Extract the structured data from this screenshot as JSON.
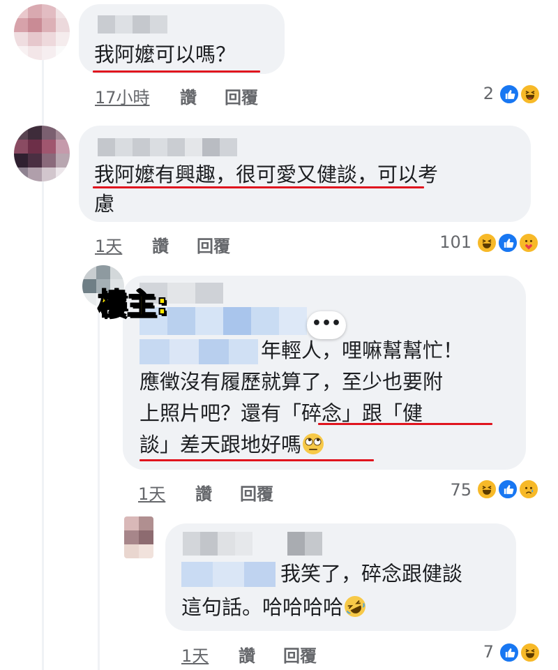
{
  "comments": [
    {
      "text": "我阿嬤可以嗎？",
      "time": "17小時",
      "like_label": "讚",
      "reply_label": "回覆",
      "reaction_count": "2"
    },
    {
      "text_line1": "我阿嬤有興趣，很可愛又健談，可以考",
      "text_line2": "慮",
      "time": "1天",
      "like_label": "讚",
      "reply_label": "回覆",
      "reaction_count": "101"
    },
    {
      "badge": "樓主:",
      "more_label": "•••",
      "text_line1": "年輕人，哩嘛幫幫忙！",
      "text_line2": "應徵沒有履歷就算了，至少也要附",
      "text_line3": "上照片吧？還有「碎念」跟「健",
      "text_line4": "談」差天跟地好嗎",
      "time": "1天",
      "like_label": "讚",
      "reply_label": "回覆",
      "reaction_count": "75"
    },
    {
      "text_line1": "我笑了，碎念跟健談",
      "text_line2": "這句話。哈哈哈哈",
      "time": "1天",
      "like_label": "讚",
      "reply_label": "回覆",
      "reaction_count": "7"
    }
  ],
  "colors": {
    "bubble": "#f0f2f5",
    "underline": "#e0141e",
    "like": "#1877f2",
    "emoji_yellow": "#f7b928",
    "badge_yellow": "#ffe600"
  }
}
